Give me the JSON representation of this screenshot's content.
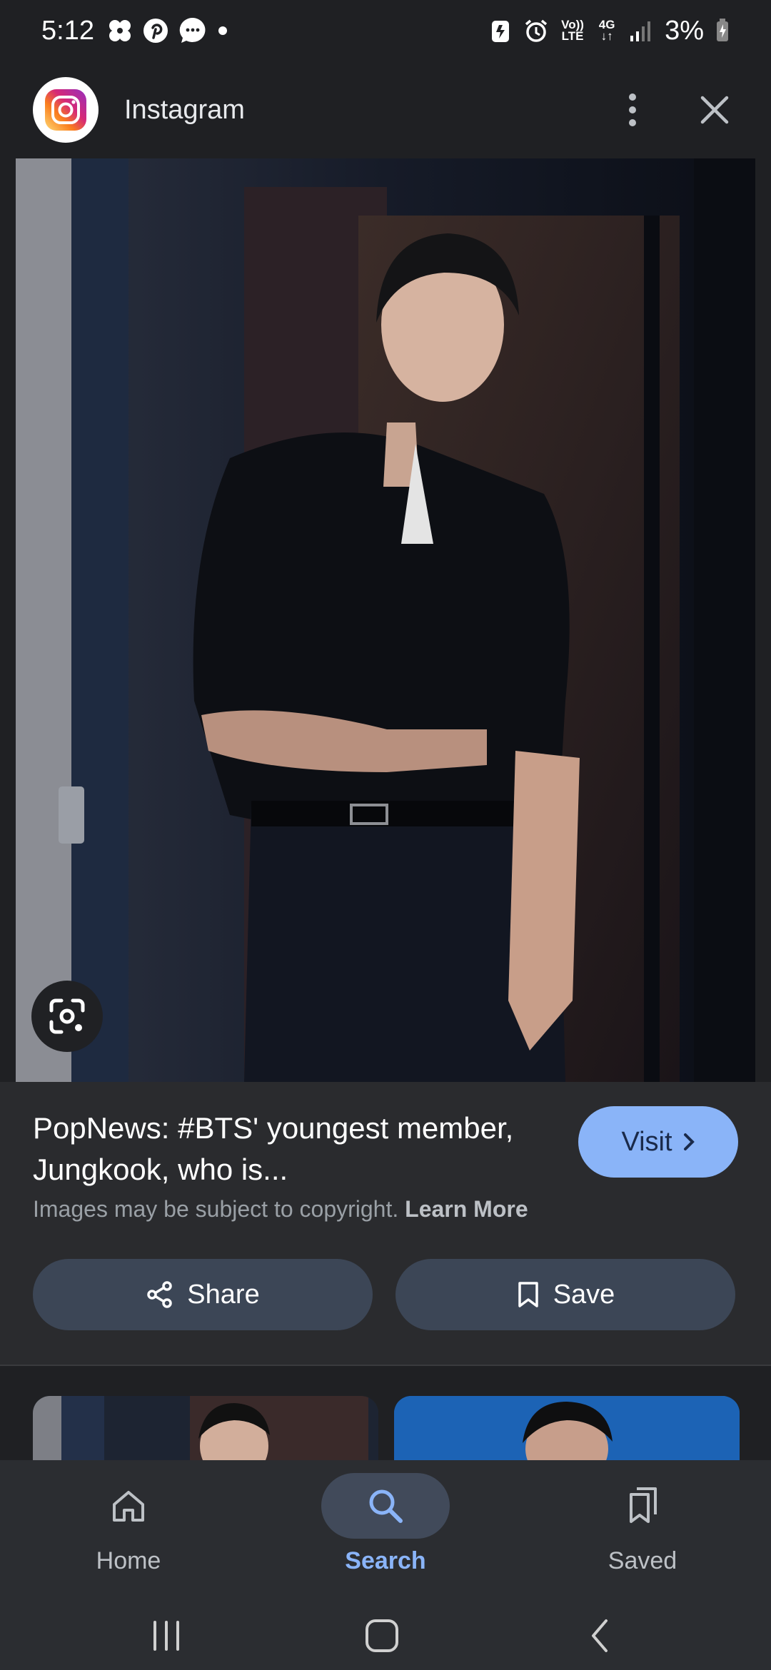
{
  "status_bar": {
    "time": "5:12",
    "battery": "3%",
    "network": "4G",
    "volte": "Vo)) LTE"
  },
  "header": {
    "app_name": "Instagram"
  },
  "result": {
    "title": "PopNews: #BTS' youngest member, Jungkook, who is...",
    "copyright_text": "Images may be subject to copyright.",
    "learn_more": "Learn More",
    "visit_label": "Visit"
  },
  "actions": {
    "share_label": "Share",
    "save_label": "Save"
  },
  "bottom_nav": {
    "items": [
      {
        "label": "Home",
        "icon": "home-icon"
      },
      {
        "label": "Search",
        "icon": "search-icon",
        "active": true
      },
      {
        "label": "Saved",
        "icon": "saved-icon"
      }
    ]
  },
  "colors": {
    "accent": "#8ab4f8",
    "background": "#1f2023",
    "panel": "#2a2b2e",
    "button": "#3c4656"
  }
}
